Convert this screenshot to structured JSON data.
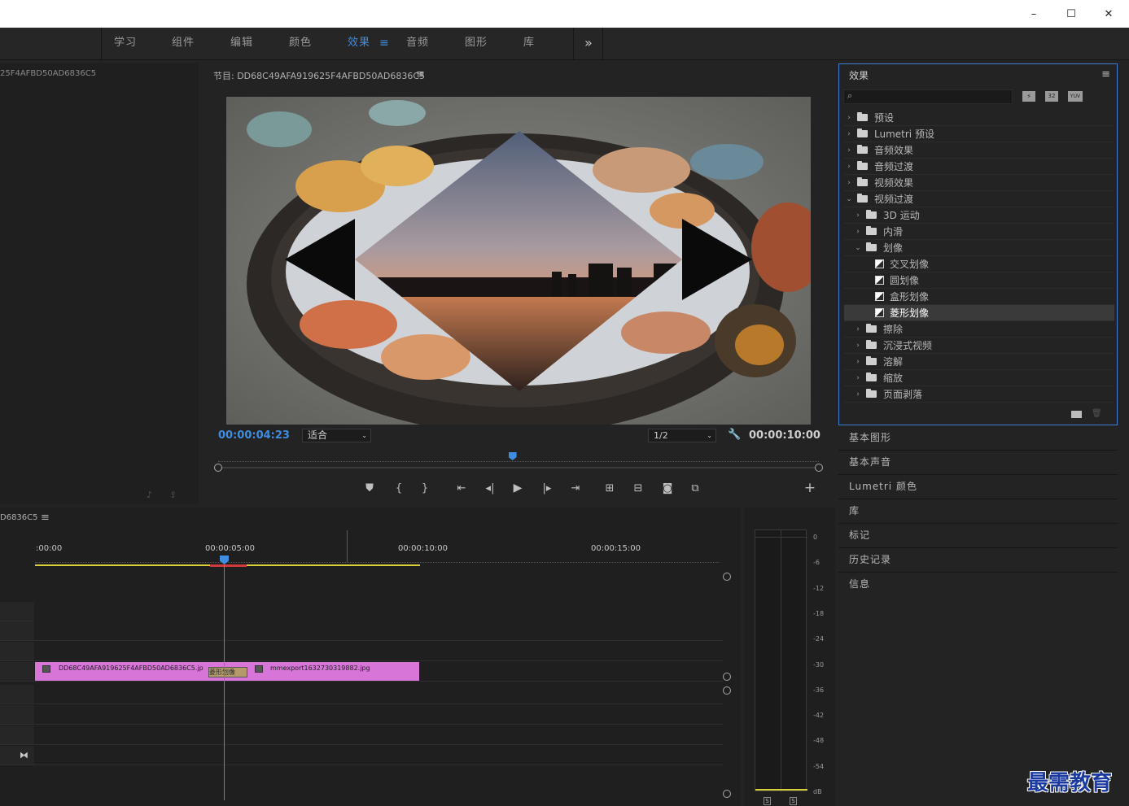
{
  "window": {
    "controls": [
      "–",
      "☐",
      "✕"
    ]
  },
  "workspaces": {
    "tabs": [
      "学习",
      "组件",
      "编辑",
      "颜色",
      "效果",
      "音频",
      "图形",
      "库"
    ],
    "active_index": 4,
    "menu_icon": "≡",
    "more_icon": "»"
  },
  "source": {
    "title": "25F4AFBD50AD6836C5"
  },
  "program": {
    "title": "节目: DD68C49AFA919625F4AFBD50AD6836C5",
    "menu": "≡",
    "timecode": "00:00:04:23",
    "fit": "适合",
    "resolution": "1/2",
    "duration": "00:00:10:00",
    "playhead_fraction": 0.49,
    "add_icon": "+"
  },
  "effects": {
    "title": "效果",
    "menu": "≡",
    "search_placeholder": "",
    "badge1": "32",
    "badge2": "YUV",
    "tree": [
      {
        "label": "预设",
        "level": 0,
        "expanded": false,
        "kind": "preset"
      },
      {
        "label": "Lumetri 预设",
        "level": 0,
        "expanded": false,
        "kind": "preset"
      },
      {
        "label": "音频效果",
        "level": 0,
        "expanded": false,
        "kind": "folder"
      },
      {
        "label": "音频过渡",
        "level": 0,
        "expanded": false,
        "kind": "folder"
      },
      {
        "label": "视频效果",
        "level": 0,
        "expanded": false,
        "kind": "folder"
      },
      {
        "label": "视频过渡",
        "level": 0,
        "expanded": true,
        "kind": "folder"
      },
      {
        "label": "3D 运动",
        "level": 1,
        "expanded": false,
        "kind": "folder"
      },
      {
        "label": "内滑",
        "level": 1,
        "expanded": false,
        "kind": "folder"
      },
      {
        "label": "划像",
        "level": 1,
        "expanded": true,
        "kind": "folder"
      },
      {
        "label": "交叉划像",
        "level": 2,
        "kind": "item"
      },
      {
        "label": "圆划像",
        "level": 2,
        "kind": "item"
      },
      {
        "label": "盒形划像",
        "level": 2,
        "kind": "item"
      },
      {
        "label": "菱形划像",
        "level": 2,
        "kind": "item",
        "selected": true
      },
      {
        "label": "擦除",
        "level": 1,
        "expanded": false,
        "kind": "folder"
      },
      {
        "label": "沉浸式视频",
        "level": 1,
        "expanded": false,
        "kind": "folder"
      },
      {
        "label": "溶解",
        "level": 1,
        "expanded": false,
        "kind": "folder"
      },
      {
        "label": "缩放",
        "level": 1,
        "expanded": false,
        "kind": "folder"
      },
      {
        "label": "页面剥落",
        "level": 1,
        "expanded": false,
        "kind": "folder"
      }
    ]
  },
  "side_panels": [
    "基本图形",
    "基本声音",
    "Lumetri 颜色",
    "库",
    "标记",
    "历史记录",
    "信息"
  ],
  "timeline": {
    "title": "D6836C5",
    "menu": "≡",
    "ruler": [
      ":00:00",
      "00:00:05:00",
      "00:00:10:00",
      "00:00:15:00"
    ],
    "clips": [
      {
        "name": "DD68C49AFA919625F4AFBD50AD6836C5.jp",
        "color": "#e07ce0"
      },
      {
        "name": "mmexport1632730319882.jpg",
        "color": "#e07ce0"
      }
    ],
    "transition_label": "菱形划像"
  },
  "meter": {
    "scale": [
      "0",
      "-6",
      "-12",
      "-18",
      "-24",
      "-30",
      "-36",
      "-42",
      "-48",
      "-54",
      "dB"
    ],
    "solo": [
      "S",
      "S"
    ]
  },
  "watermark": "最需教育"
}
